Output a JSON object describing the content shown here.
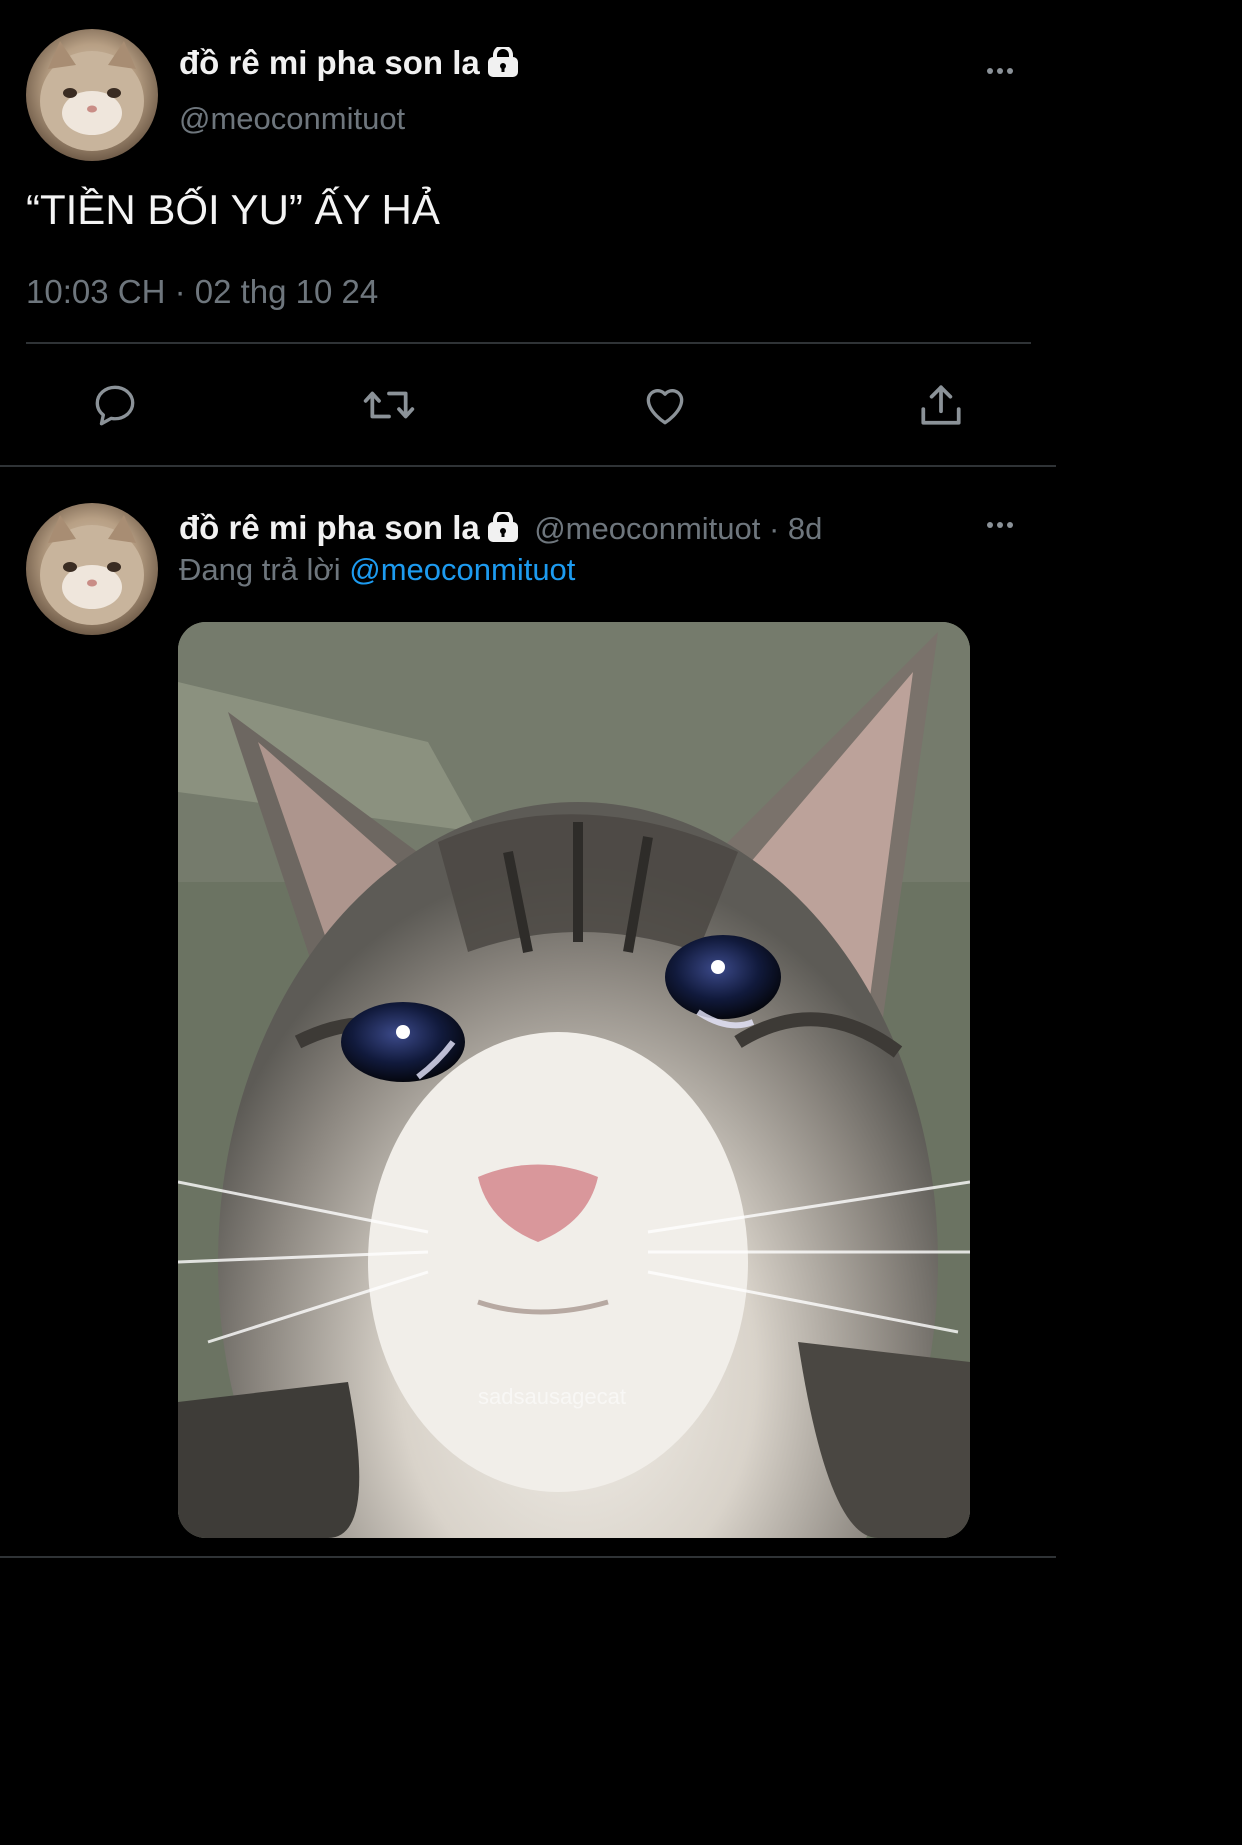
{
  "main_tweet": {
    "display_name": "đồ rê mi pha son la",
    "handle": "@meoconmituot",
    "text": "“TIỀN BỐI YU” ẤY HẢ",
    "timestamp": "10:03 CH · 02 thg 10 24",
    "avatar_icon": "cat-avatar",
    "verified_lock_icon": "lock-icon"
  },
  "actions": [
    {
      "icon": "reply-icon"
    },
    {
      "icon": "retweet-icon"
    },
    {
      "icon": "like-icon"
    },
    {
      "icon": "share-icon"
    }
  ],
  "reply_tweet": {
    "display_name": "đồ rê mi pha son la",
    "handle_time": "@meoconmituot · 8d",
    "replying_prefix": "Đang trả lời ",
    "replying_to": "@meoconmituot",
    "media_watermark": "sadsausagecat",
    "media_icon": "crying-cat-photo"
  },
  "colors": {
    "background": "#000000",
    "text_primary": "#e7e9ea",
    "text_secondary": "#6e767d",
    "accent": "#1d9bf0",
    "divider": "#2f3336"
  }
}
